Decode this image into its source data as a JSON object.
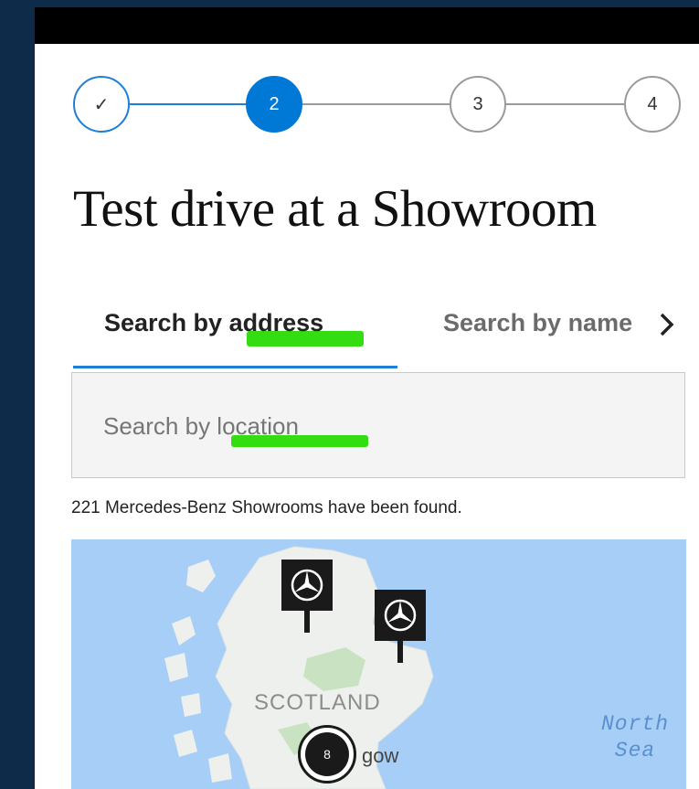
{
  "stepper": {
    "steps": [
      {
        "label": "✓",
        "state": "done"
      },
      {
        "label": "2",
        "state": "active"
      },
      {
        "label": "3",
        "state": "pending"
      },
      {
        "label": "4",
        "state": "pending"
      }
    ],
    "colors": {
      "active": "#0078d6",
      "done_border": "#1f7fd6",
      "pending_border": "#9a9a9a"
    }
  },
  "page": {
    "title": "Test drive at a Showroom"
  },
  "tabs": {
    "items": [
      {
        "label": "Search by address",
        "selected": true
      },
      {
        "label": "Search by name",
        "selected": false
      }
    ],
    "next_icon": "chevron-right-icon"
  },
  "search": {
    "placeholder": "Search by location",
    "value": ""
  },
  "results": {
    "count_text": "221 Mercedes-Benz Showrooms have been found."
  },
  "map": {
    "labels": {
      "country": "SCOTLAND",
      "sea_line1": "North",
      "sea_line2": "Sea",
      "city_fragment": "gow"
    },
    "cluster_count": "8",
    "pin_icon": "mercedes-star-icon",
    "colors": {
      "water": "#a7cef6",
      "land": "#eef0ee",
      "green": "#c9e3c2",
      "pin": "#1a1a1a"
    }
  }
}
